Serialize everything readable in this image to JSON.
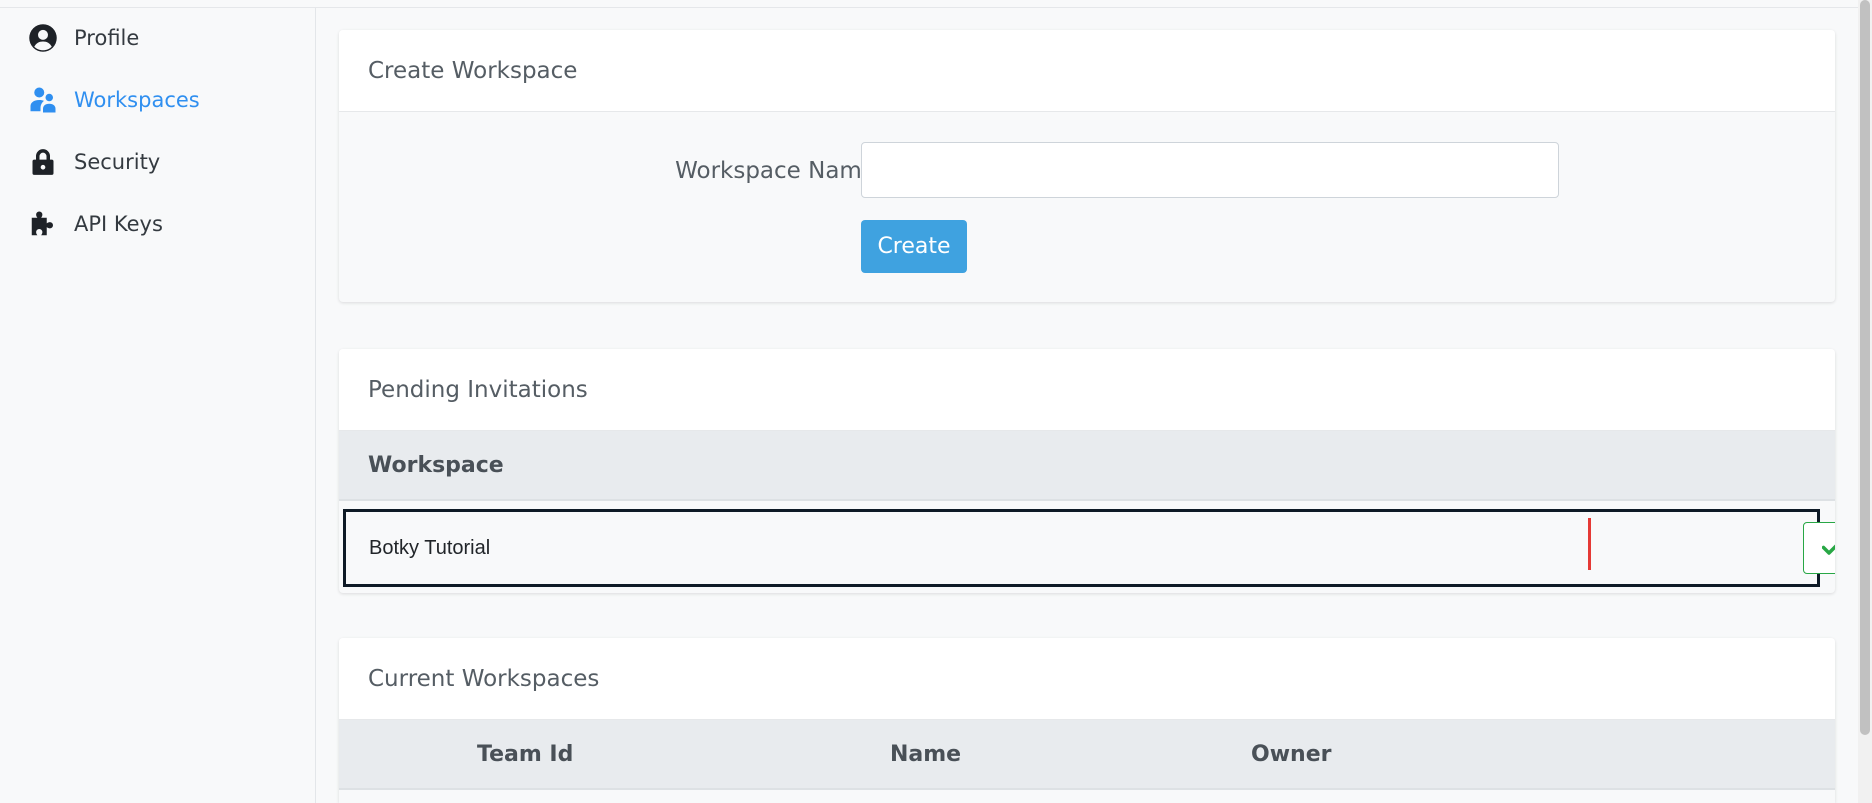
{
  "sidebar": {
    "items": [
      {
        "label": "Profile",
        "icon": "user-circle-icon",
        "active": false
      },
      {
        "label": "Workspaces",
        "icon": "users-icon",
        "active": true
      },
      {
        "label": "Security",
        "icon": "lock-icon",
        "active": false
      },
      {
        "label": "API Keys",
        "icon": "puzzle-icon",
        "active": false
      }
    ]
  },
  "create_workspace": {
    "title": "Create Workspace",
    "field_label": "Workspace Name",
    "field_value": "",
    "button_label": "Create"
  },
  "pending_invitations": {
    "title": "Pending Invitations",
    "column_header": "Workspace",
    "rows": [
      {
        "workspace": "Botky Tutorial"
      }
    ]
  },
  "current_workspaces": {
    "title": "Current Workspaces",
    "columns": [
      "Team Id",
      "Name",
      "Owner"
    ]
  },
  "colors": {
    "accent": "#2f8ff0",
    "create_button": "#3fa2e0",
    "accept": "#28a745",
    "decline": "#dc3545"
  }
}
